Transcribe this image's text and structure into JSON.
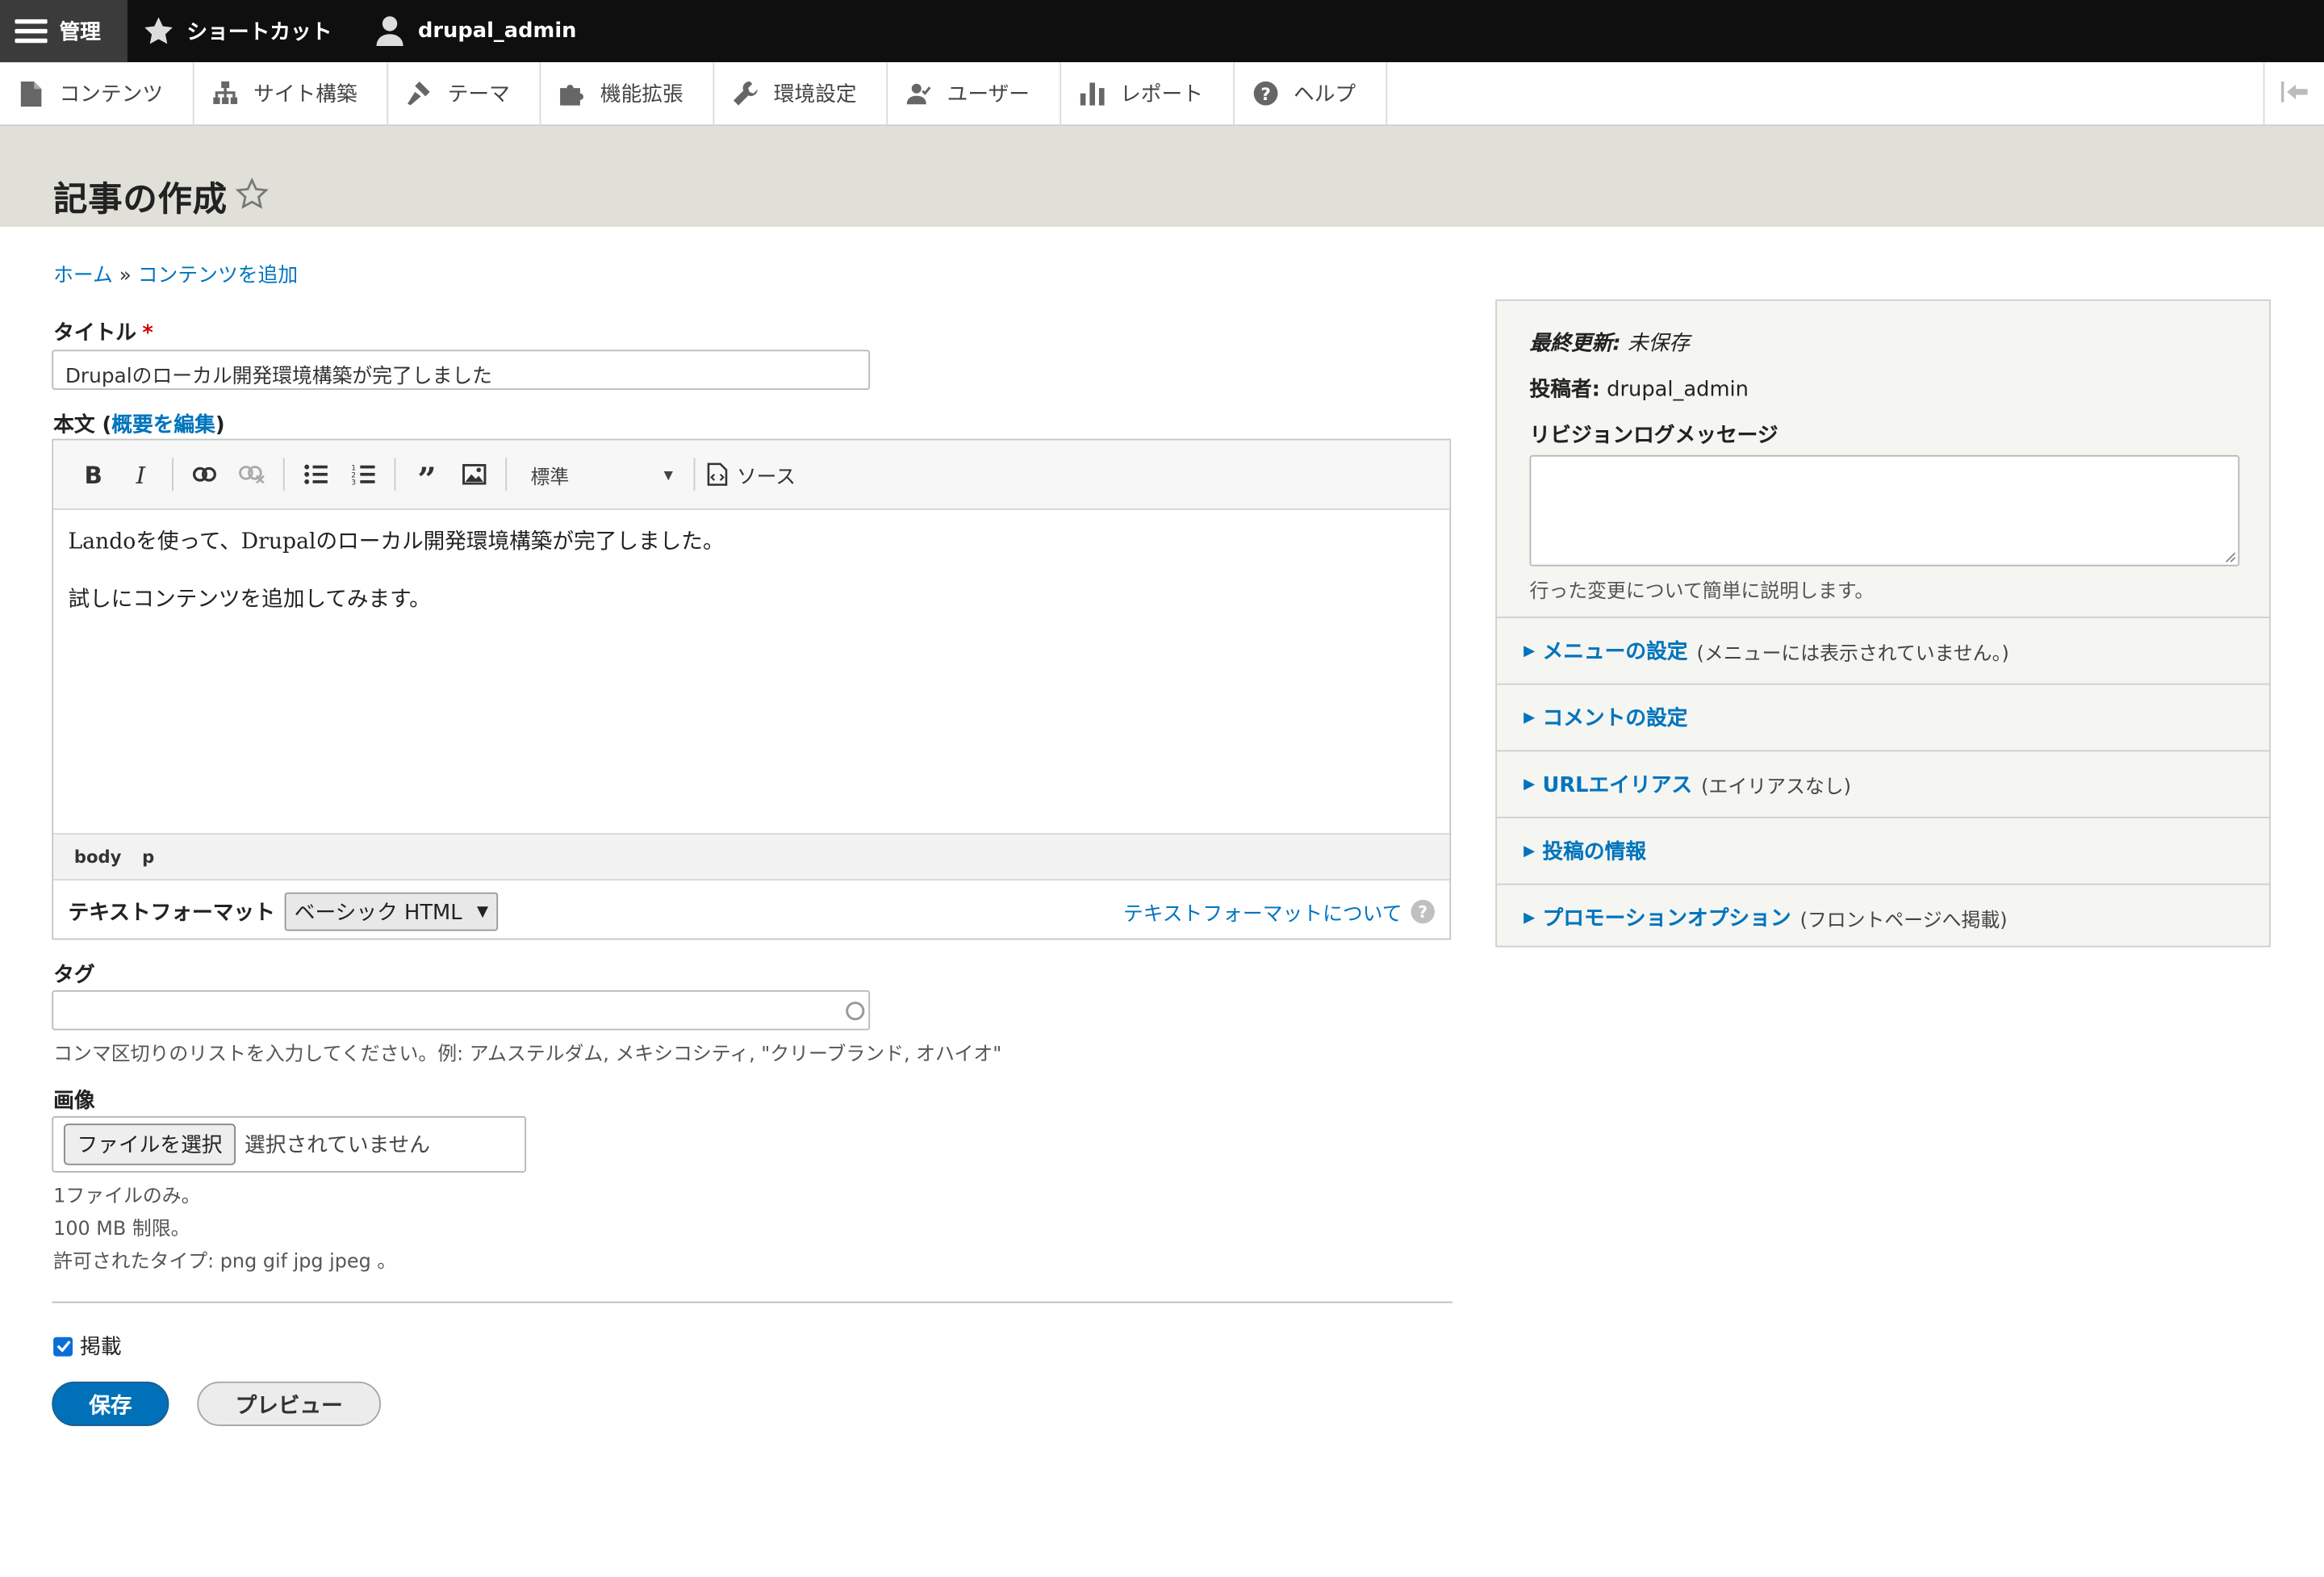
{
  "toolbar": {
    "manage": "管理",
    "shortcuts": "ショートカット",
    "user": "drupal_admin"
  },
  "tray": {
    "items": [
      "コンテンツ",
      "サイト構築",
      "テーマ",
      "機能拡張",
      "環境設定",
      "ユーザー",
      "レポート",
      "ヘルプ"
    ]
  },
  "page": {
    "title": "記事の作成"
  },
  "breadcrumb": {
    "home": "ホーム",
    "sep": "»",
    "add": "コンテンツを追加"
  },
  "form": {
    "title_label": "タイトル",
    "required_mark": "*",
    "title_value": "Drupalのローカル開発環境構築が完了しました",
    "body_label": "本文 (",
    "body_edit_summary": "概要を編集",
    "body_label_close": ")",
    "editor": {
      "format_select": "標準",
      "source_label": "ソース",
      "paragraphs": [
        "Landoを使って、Drupalのローカル開発環境構築が完了しました。",
        "試しにコンテンツを追加してみます。"
      ],
      "path": [
        "body",
        "p"
      ]
    },
    "text_format_label": "テキストフォーマット",
    "text_format_value": "ベーシック HTML",
    "text_format_about": "テキストフォーマットについて",
    "tags_label": "タグ",
    "tags_value": "",
    "tags_help": "コンマ区切りのリストを入力してください。例: アムステルダム, メキシコシティ, \"クリーブランド, オハイオ\"",
    "image_label": "画像",
    "file_button": "ファイルを選択",
    "file_none": "選択されていません",
    "file_help_1": "1ファイルのみ。",
    "file_help_2": "100 MB 制限。",
    "file_help_3": "許可されたタイプ: png gif jpg jpeg 。",
    "published_label": "掲載",
    "published_checked": true,
    "save_label": "保存",
    "preview_label": "プレビュー"
  },
  "sidebar": {
    "last_updated_label": "最終更新:",
    "last_updated_value": "未保存",
    "author_label": "投稿者:",
    "author_value": "drupal_admin",
    "revision_label": "リビジョンログメッセージ",
    "revision_value": "",
    "revision_help": "行った変更について簡単に説明します。",
    "sections": [
      {
        "title": "メニューの設定",
        "summary": "(メニューには表示されていません。)"
      },
      {
        "title": "コメントの設定",
        "summary": ""
      },
      {
        "title": "URLエイリアス",
        "summary": "(エイリアスなし)"
      },
      {
        "title": "投稿の情報",
        "summary": ""
      },
      {
        "title": "プロモーションオプション",
        "summary": "(フロントページへ掲載)"
      }
    ]
  },
  "colors": {
    "link": "#0074bd",
    "primary_button": "#0071b8",
    "toolbar_bg": "#0f0f0f",
    "header_bg": "#e0e0d8",
    "required": "#cc0000"
  }
}
